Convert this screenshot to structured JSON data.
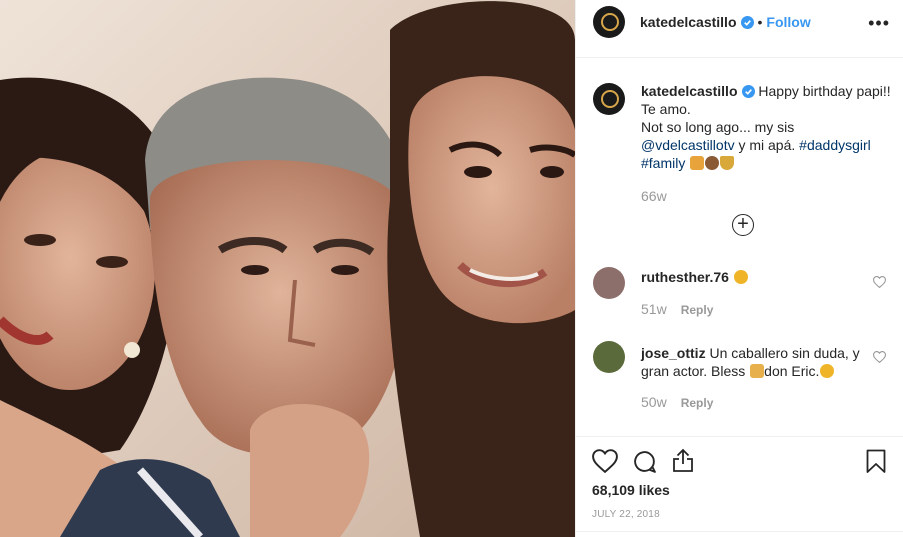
{
  "post": {
    "username": "katedelcastillo",
    "follow_label": "Follow",
    "dot": "•",
    "more_glyph": "•••"
  },
  "caption": {
    "username": "katedelcastillo",
    "text_1": "Happy birthday papi!! Te amo.",
    "text_2": "Not so long ago... my sis",
    "mention": "@vdelcastillotv",
    "text_3": "y mi apá.",
    "hashtag_1": "#daddysgirl",
    "hashtag_2": "#family",
    "time": "66w"
  },
  "comments": [
    {
      "username": "ruthesther.76",
      "text": "",
      "time": "51w",
      "reply_label": "Reply"
    },
    {
      "username": "jose_ottiz",
      "text_1": "Un caballero sin duda, y gran actor. Bless",
      "text_2": "don Eric.",
      "time": "50w",
      "reply_label": "Reply"
    }
  ],
  "stats": {
    "likes": "68,109 likes",
    "date": "JULY 22, 2018"
  },
  "icons": {
    "verified": "verified-badge-icon",
    "heart": "heart-icon",
    "comment": "comment-icon",
    "share": "share-icon",
    "save": "bookmark-icon",
    "load_more": "plus-circle-icon"
  },
  "colors": {
    "link": "#003569",
    "follow": "#3897f0",
    "muted": "#999999",
    "verified": "#3897f0"
  }
}
